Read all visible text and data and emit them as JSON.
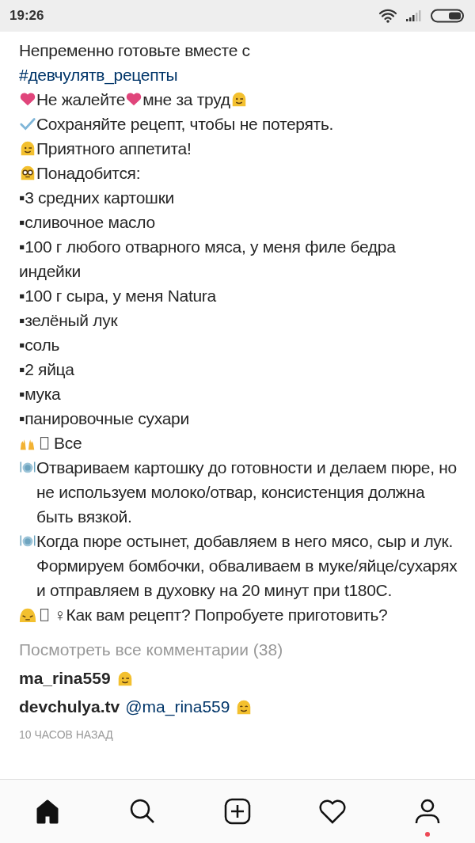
{
  "status_bar": {
    "time": "19:26"
  },
  "post_lines": [
    {
      "parts": [
        {
          "kind": "text",
          "text": "Непременно готовьте вместе с"
        }
      ]
    },
    {
      "parts": [
        {
          "kind": "hashtag",
          "text": "#девчулятв_рецепты"
        }
      ]
    },
    {
      "parts": [
        {
          "kind": "heart"
        },
        {
          "kind": "text",
          "text": "Не жалейте"
        },
        {
          "kind": "heart"
        },
        {
          "kind": "text",
          "text": "мне за труд"
        },
        {
          "kind": "wink"
        }
      ]
    },
    {
      "parts": [
        {
          "kind": "check"
        },
        {
          "kind": "text",
          "text": "Сохраняйте рецепт, чтобы не потерять."
        }
      ]
    },
    {
      "parts": [
        {
          "kind": "wink"
        },
        {
          "kind": "text",
          "text": "Приятного аппетита!"
        }
      ]
    },
    {
      "parts": [
        {
          "kind": "nerd"
        },
        {
          "kind": "text",
          "text": "Понадобится:"
        }
      ]
    },
    {
      "parts": [
        {
          "kind": "text",
          "text": "▪3 средних картошки"
        }
      ]
    },
    {
      "parts": [
        {
          "kind": "text",
          "text": "▪сливочное масло"
        }
      ]
    },
    {
      "parts": [
        {
          "kind": "text",
          "text": "▪100 г любого отварного мяса, у меня филе бедра индейки"
        }
      ]
    },
    {
      "parts": [
        {
          "kind": "text",
          "text": "▪100 г сыра, у меня Natura"
        }
      ]
    },
    {
      "parts": [
        {
          "kind": "text",
          "text": "▪зелёный лук"
        }
      ]
    },
    {
      "parts": [
        {
          "kind": "text",
          "text": "▪соль"
        }
      ]
    },
    {
      "parts": [
        {
          "kind": "text",
          "text": "▪2 яйца"
        }
      ]
    },
    {
      "parts": [
        {
          "kind": "text",
          "text": "▪мука"
        }
      ]
    },
    {
      "parts": [
        {
          "kind": "text",
          "text": "▪панировочные сухари"
        }
      ]
    },
    {
      "parts": [
        {
          "kind": "hands"
        },
        {
          "kind": "tofu"
        },
        {
          "kind": "text",
          "text": "Все"
        }
      ]
    },
    {
      "parts": [
        {
          "kind": "plate"
        },
        {
          "kind": "text",
          "text": "Отвариваем картошку до готовности и делаем пюре, но не используем молоко/отвар, консистенция должна быть вязкой."
        }
      ]
    },
    {
      "parts": [
        {
          "kind": "plate"
        },
        {
          "kind": "text",
          "text": "Когда пюре остынет, добавляем в него мясо, сыр и лук. Формируем бомбочки, обваливаем в муке/яйце/сухарях и отправляем в духовку на 20 минут при t180C."
        }
      ]
    },
    {
      "parts": [
        {
          "kind": "sleepy"
        },
        {
          "kind": "tofu"
        },
        {
          "kind": "text",
          "text": "♀Как вам рецепт? Попробуете приготовить?"
        }
      ]
    }
  ],
  "view_comments": "Посмотреть все комментарии (38)",
  "comments": [
    {
      "user": "ma_rina559",
      "parts": [
        {
          "kind": "wink"
        }
      ]
    },
    {
      "user": "devchulya.tv",
      "parts": [
        {
          "kind": "mention",
          "text": "@ma_rina559"
        },
        {
          "kind": "smile"
        }
      ]
    }
  ],
  "time_ago": "10 ЧАСОВ НАЗАД",
  "nav": [
    {
      "kind": "home",
      "selected": true,
      "badge": false
    },
    {
      "kind": "search",
      "selected": false,
      "badge": false
    },
    {
      "kind": "add",
      "selected": false,
      "badge": false
    },
    {
      "kind": "heart",
      "selected": false,
      "badge": false
    },
    {
      "kind": "profile",
      "selected": false,
      "badge": true
    }
  ]
}
